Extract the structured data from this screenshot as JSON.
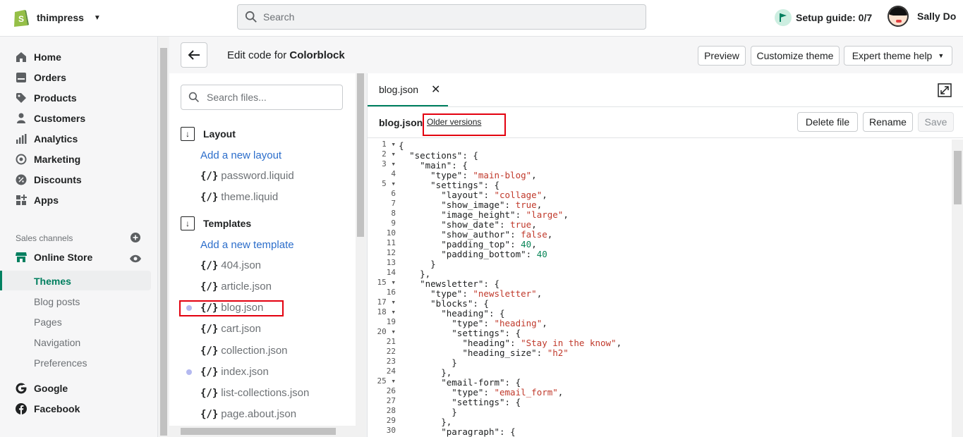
{
  "topbar": {
    "store_name": "thimpress",
    "search_placeholder": "Search",
    "setup_guide": "Setup guide: 0/7",
    "user_name": "Sally Do"
  },
  "sidebar": {
    "items": [
      {
        "label": "Home",
        "icon": "home-icon"
      },
      {
        "label": "Orders",
        "icon": "orders-icon"
      },
      {
        "label": "Products",
        "icon": "tag-icon"
      },
      {
        "label": "Customers",
        "icon": "person-icon"
      },
      {
        "label": "Analytics",
        "icon": "bar-chart-icon"
      },
      {
        "label": "Marketing",
        "icon": "target-icon"
      },
      {
        "label": "Discounts",
        "icon": "discount-icon"
      },
      {
        "label": "Apps",
        "icon": "apps-icon"
      }
    ],
    "sales_channels_label": "Sales channels",
    "online_store": "Online Store",
    "sub_items": [
      "Themes",
      "Blog posts",
      "Pages",
      "Navigation",
      "Preferences"
    ],
    "google": "Google",
    "facebook": "Facebook"
  },
  "editor": {
    "title_prefix": "Edit code for",
    "theme_name": "Colorblock",
    "preview": "Preview",
    "customize": "Customize theme",
    "expert_help": "Expert theme help"
  },
  "files": {
    "search_placeholder": "Search files...",
    "layout_folder": "Layout",
    "add_layout": "Add a new layout",
    "layout_files": [
      "password.liquid",
      "theme.liquid"
    ],
    "templates_folder": "Templates",
    "add_template": "Add a new template",
    "template_files": [
      "404.json",
      "article.json",
      "blog.json",
      "cart.json",
      "collection.json",
      "index.json",
      "list-collections.json",
      "page.about.json"
    ],
    "file_prefix": "{/}"
  },
  "code_panel": {
    "tab_name": "blog.json",
    "file_name": "blog.json",
    "older_versions": "Older versions",
    "delete": "Delete file",
    "rename": "Rename",
    "save": "Save"
  },
  "code_lines": [
    "{",
    "  \"sections\": {",
    "    \"main\": {",
    "      \"type\": \"main-blog\",",
    "      \"settings\": {",
    "        \"layout\": \"collage\",",
    "        \"show_image\": true,",
    "        \"image_height\": \"large\",",
    "        \"show_date\": true,",
    "        \"show_author\": false,",
    "        \"padding_top\": 40,",
    "        \"padding_bottom\": 40",
    "      }",
    "    },",
    "    \"newsletter\": {",
    "      \"type\": \"newsletter\",",
    "      \"blocks\": {",
    "        \"heading\": {",
    "          \"type\": \"heading\",",
    "          \"settings\": {",
    "            \"heading\": \"Stay in the know\",",
    "            \"heading_size\": \"h2\"",
    "          }",
    "        },",
    "        \"email-form\": {",
    "          \"type\": \"email_form\",",
    "          \"settings\": {",
    "          }",
    "        },",
    "        \"paragraph\": {"
  ]
}
